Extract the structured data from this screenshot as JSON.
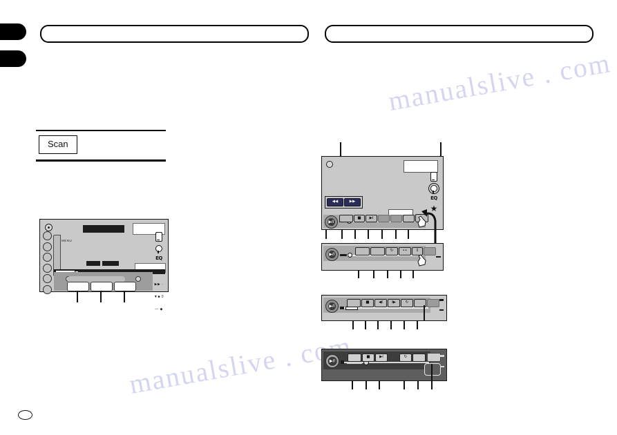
{
  "document": {
    "type": "car-audio-owners-manual-page",
    "page_marker": ""
  },
  "header": {
    "left_bar_text": "",
    "right_bar_text": "",
    "tab_top_label": "",
    "tab_bottom_label": ""
  },
  "table": {
    "cell_label": "Scan"
  },
  "left_figure": {
    "name": "head-unit-front-panel",
    "screen_label": "MENU",
    "rail_icons": [
      "device-icon",
      "bulb-icon",
      "eq-icon",
      "star-icon"
    ],
    "eq_text": "EQ",
    "star_glyph": "★",
    "keys": [
      "",
      "",
      ""
    ],
    "callouts": [
      "",
      "",
      ""
    ]
  },
  "figures": [
    {
      "name": "touch-panel-playback-screen-1",
      "transport": {
        "rewind": "◀◀",
        "forward": "▶▶"
      },
      "play_button": "▶II",
      "softkeys": [
        "",
        "■",
        "▶I",
        "",
        "",
        "",
        ""
      ],
      "rail_icons": [
        "device-icon",
        "bulb-icon",
        "eq-icon",
        "star-icon"
      ],
      "eq_text": "EQ",
      "star_glyph": "★",
      "callouts": [
        "",
        "",
        "",
        "",
        "",
        "",
        "",
        ""
      ]
    },
    {
      "name": "touch-panel-playback-screen-2",
      "play_button": "▶II",
      "softkeys": [
        "",
        "",
        "↻",
        "••",
        "↕",
        ""
      ],
      "callouts": [
        "",
        "",
        "",
        "",
        "",
        ""
      ]
    },
    {
      "name": "touch-panel-playback-screen-3",
      "play_button": "▶II",
      "softkeys": [
        "",
        "■",
        "◀I",
        "I▶",
        "↻",
        ""
      ],
      "callouts": [
        "",
        "",
        "",
        "",
        "",
        "",
        ""
      ]
    },
    {
      "name": "touch-panel-playback-screen-4-inverted",
      "play_button": "▶II",
      "softkeys": [
        "",
        "■",
        "▶I",
        "↻",
        ""
      ],
      "callouts": [
        "",
        "",
        "",
        "",
        "",
        ""
      ]
    }
  ],
  "watermark": {
    "line1": "manualslive . com",
    "line2": "manualslive . com"
  },
  "colors": {
    "accent_transport": "#2c2c58",
    "panel_grey": "#c9c9c9",
    "screen_dark": "#1d1d1d",
    "watermark": "#cdd0ef"
  }
}
